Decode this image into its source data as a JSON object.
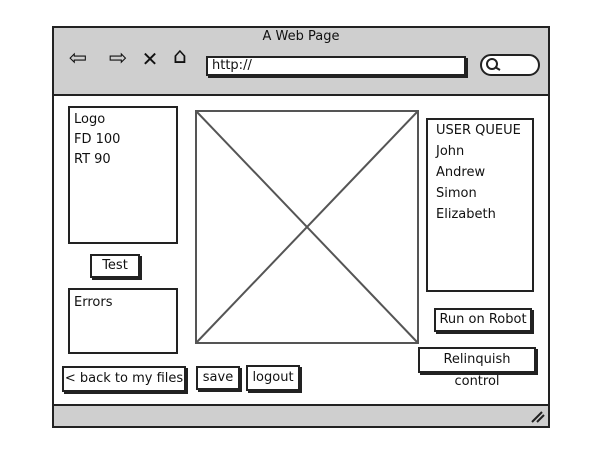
{
  "window": {
    "title": "A Web Page"
  },
  "address_bar": {
    "url": "http://"
  },
  "nav": {
    "back_icon": "back-arrow-icon",
    "forward_icon": "forward-arrow-icon",
    "close_icon": "close-icon",
    "home_icon": "home-icon",
    "search_icon": "search-icon"
  },
  "program_panel": {
    "lines": [
      "Logo",
      "FD 100",
      "RT 90"
    ]
  },
  "test_button": {
    "label": "Test"
  },
  "errors_panel": {
    "label": "Errors"
  },
  "user_queue": {
    "header": "USER QUEUE",
    "users": [
      "John",
      "Andrew",
      "Simon",
      "Elizabeth"
    ]
  },
  "buttons": {
    "run_on_robot": "Run on Robot",
    "relinquish_control": "Relinquish control",
    "back_to_my_files": "< back to my files",
    "save": "save",
    "logout": "logout"
  }
}
